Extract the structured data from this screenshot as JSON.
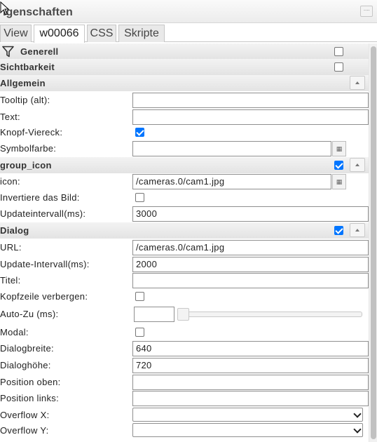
{
  "panel": {
    "title": "igenschaften",
    "menu_icon": "menu-dots-icon"
  },
  "tabs": [
    {
      "label": "View",
      "active": false
    },
    {
      "label": "w00066",
      "active": true
    },
    {
      "label": "CSS",
      "active": false
    },
    {
      "label": "Skripte",
      "active": false
    }
  ],
  "groups": {
    "generell": {
      "title": "Generell",
      "checked": false,
      "icon": "filter-icon"
    },
    "sichtbarkeit": {
      "title": "Sichtbarkeit",
      "checked": false
    },
    "allgemein": {
      "title": "Allgemein"
    },
    "group_icon": {
      "title": "group_icon",
      "checked": true
    },
    "dialog": {
      "title": "Dialog",
      "checked": true
    }
  },
  "allgemein": {
    "tooltip": {
      "label": "Tooltip (alt):",
      "value": ""
    },
    "text": {
      "label": "Text:",
      "value": ""
    },
    "knopf_viereck": {
      "label": "Knopf-Viereck:",
      "checked": true
    },
    "symbolfarbe": {
      "label": "Symbolfarbe:",
      "value": ""
    }
  },
  "group_icon": {
    "icon": {
      "label": "icon:",
      "value": "/cameras.0/cam1.jpg"
    },
    "invertiere": {
      "label": "Invertiere das Bild:",
      "checked": false
    },
    "updateintervall": {
      "label": "Updateintervall(ms):",
      "value": "3000"
    }
  },
  "dialog": {
    "url": {
      "label": "URL:",
      "value": "/cameras.0/cam1.jpg"
    },
    "update_intervall": {
      "label": "Update-Intervall(ms):",
      "value": "2000"
    },
    "titel": {
      "label": "Titel:",
      "value": ""
    },
    "kopfzeile": {
      "label": "Kopfzeile verbergen:",
      "checked": false
    },
    "auto_zu": {
      "label": "Auto-Zu (ms):",
      "value": "",
      "slider_value": 0
    },
    "modal": {
      "label": "Modal:",
      "checked": false
    },
    "dialogbreite": {
      "label": "Dialogbreite:",
      "value": "640"
    },
    "dialoghoehe": {
      "label": "Dialoghöhe:",
      "value": "720"
    },
    "position_oben": {
      "label": "Position oben:",
      "value": ""
    },
    "position_links": {
      "label": "Position links:",
      "value": ""
    },
    "overflow_x": {
      "label": "Overflow X:",
      "value": ""
    },
    "overflow_y": {
      "label": "Overflow Y:",
      "value": ""
    }
  },
  "colors": {
    "checkbox_checked": "#0075ff",
    "group_header": "#e3e3e3"
  }
}
